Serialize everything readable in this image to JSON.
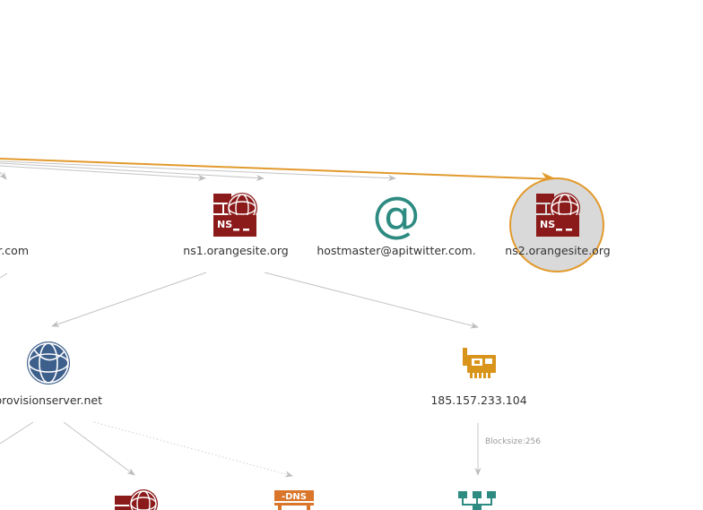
{
  "graph": {
    "nodes": {
      "partial_com": {
        "label": "r.com",
        "icon": "ns-server-icon"
      },
      "ns1": {
        "label": "ns1.orangesite.org",
        "icon": "ns-server-icon"
      },
      "hostmaster": {
        "label": "hostmaster@apitwitter.com.",
        "icon": "at-sign-icon"
      },
      "ns2": {
        "label": "ns2.orangesite.org",
        "icon": "ns-server-icon",
        "selected": true
      },
      "provision": {
        "label": "provisionserver.net",
        "icon": "globe-icon"
      },
      "ip": {
        "label": "185.157.233.104",
        "icon": "network-card-icon"
      },
      "bottom_ns": {
        "icon": "ns-server-icon"
      },
      "bottom_dns": {
        "icon": "dns-record-icon"
      },
      "bottom_netblock": {
        "icon": "netblock-icon"
      }
    },
    "edges": {
      "ip_to_netblock": "Blocksize:256"
    }
  },
  "colors": {
    "ns_icon": "#8b1a1a",
    "at_icon": "#2e8b82",
    "globe_icon": "#3d5f8c",
    "nic_icon": "#d9941c",
    "dns_icon": "#d9762a",
    "netblock_icon": "#2e8b82",
    "highlight_edge": "#e29a2d",
    "selected_fill": "#d9d9d9",
    "edge": "#c4c4c4"
  }
}
